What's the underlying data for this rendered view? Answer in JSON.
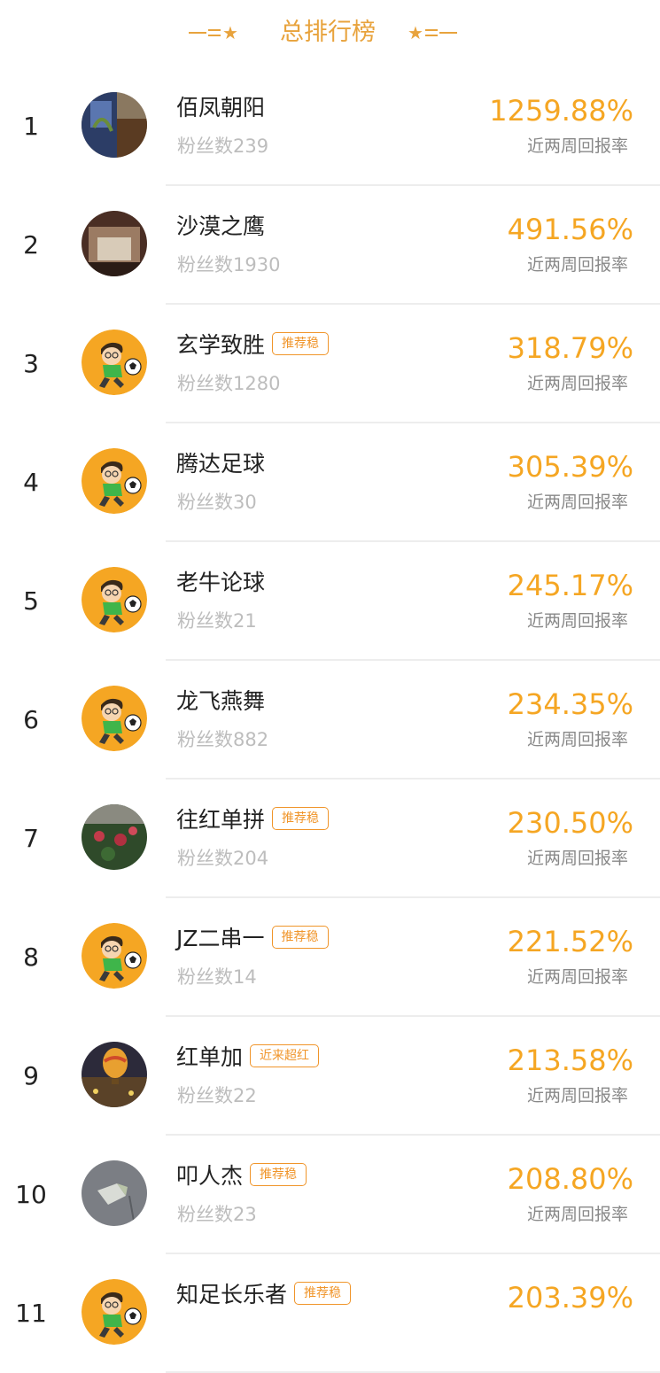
{
  "header": {
    "title": "总排行榜"
  },
  "colors": {
    "accent": "#f5a623",
    "tag": "#f0952a",
    "title": "#e8a33d"
  },
  "rows": [
    {
      "rank": "1",
      "name": "佰凤朝阳",
      "tag": "",
      "fans": "粉丝数239",
      "rate": "1259.88%",
      "rate_label": "近两周回报率",
      "avatar": "photo-living-room"
    },
    {
      "rank": "2",
      "name": "沙漠之鹰",
      "tag": "",
      "fans": "粉丝数1930",
      "rate": "491.56%",
      "rate_label": "近两周回报率",
      "avatar": "photo-storefront"
    },
    {
      "rank": "3",
      "name": "玄学致胜",
      "tag": "推荐稳",
      "fans": "粉丝数1280",
      "rate": "318.79%",
      "rate_label": "近两周回报率",
      "avatar": "soccer-boy-cartoon"
    },
    {
      "rank": "4",
      "name": "腾达足球",
      "tag": "",
      "fans": "粉丝数30",
      "rate": "305.39%",
      "rate_label": "近两周回报率",
      "avatar": "soccer-boy-cartoon"
    },
    {
      "rank": "5",
      "name": "老牛论球",
      "tag": "",
      "fans": "粉丝数21",
      "rate": "245.17%",
      "rate_label": "近两周回报率",
      "avatar": "soccer-boy-cartoon"
    },
    {
      "rank": "6",
      "name": "龙飞燕舞",
      "tag": "",
      "fans": "粉丝数882",
      "rate": "234.35%",
      "rate_label": "近两周回报率",
      "avatar": "soccer-boy-cartoon"
    },
    {
      "rank": "7",
      "name": "往红单拼",
      "tag": "推荐稳",
      "fans": "粉丝数204",
      "rate": "230.50%",
      "rate_label": "近两周回报率",
      "avatar": "photo-garden"
    },
    {
      "rank": "8",
      "name": "JZ二串一",
      "tag": "推荐稳",
      "fans": "粉丝数14",
      "rate": "221.52%",
      "rate_label": "近两周回报率",
      "avatar": "soccer-boy-cartoon"
    },
    {
      "rank": "9",
      "name": "红单加",
      "tag": "近来超红",
      "fans": "粉丝数22",
      "rate": "213.58%",
      "rate_label": "近两周回报率",
      "avatar": "photo-hot-air-balloon"
    },
    {
      "rank": "10",
      "name": "叩人杰",
      "tag": "推荐稳",
      "fans": "粉丝数23",
      "rate": "208.80%",
      "rate_label": "近两周回报率",
      "avatar": "photo-gray-object"
    },
    {
      "rank": "11",
      "name": "知足长乐者",
      "tag": "推荐稳",
      "fans": "",
      "rate": "203.39%",
      "rate_label": "",
      "avatar": "soccer-boy-cartoon"
    }
  ]
}
